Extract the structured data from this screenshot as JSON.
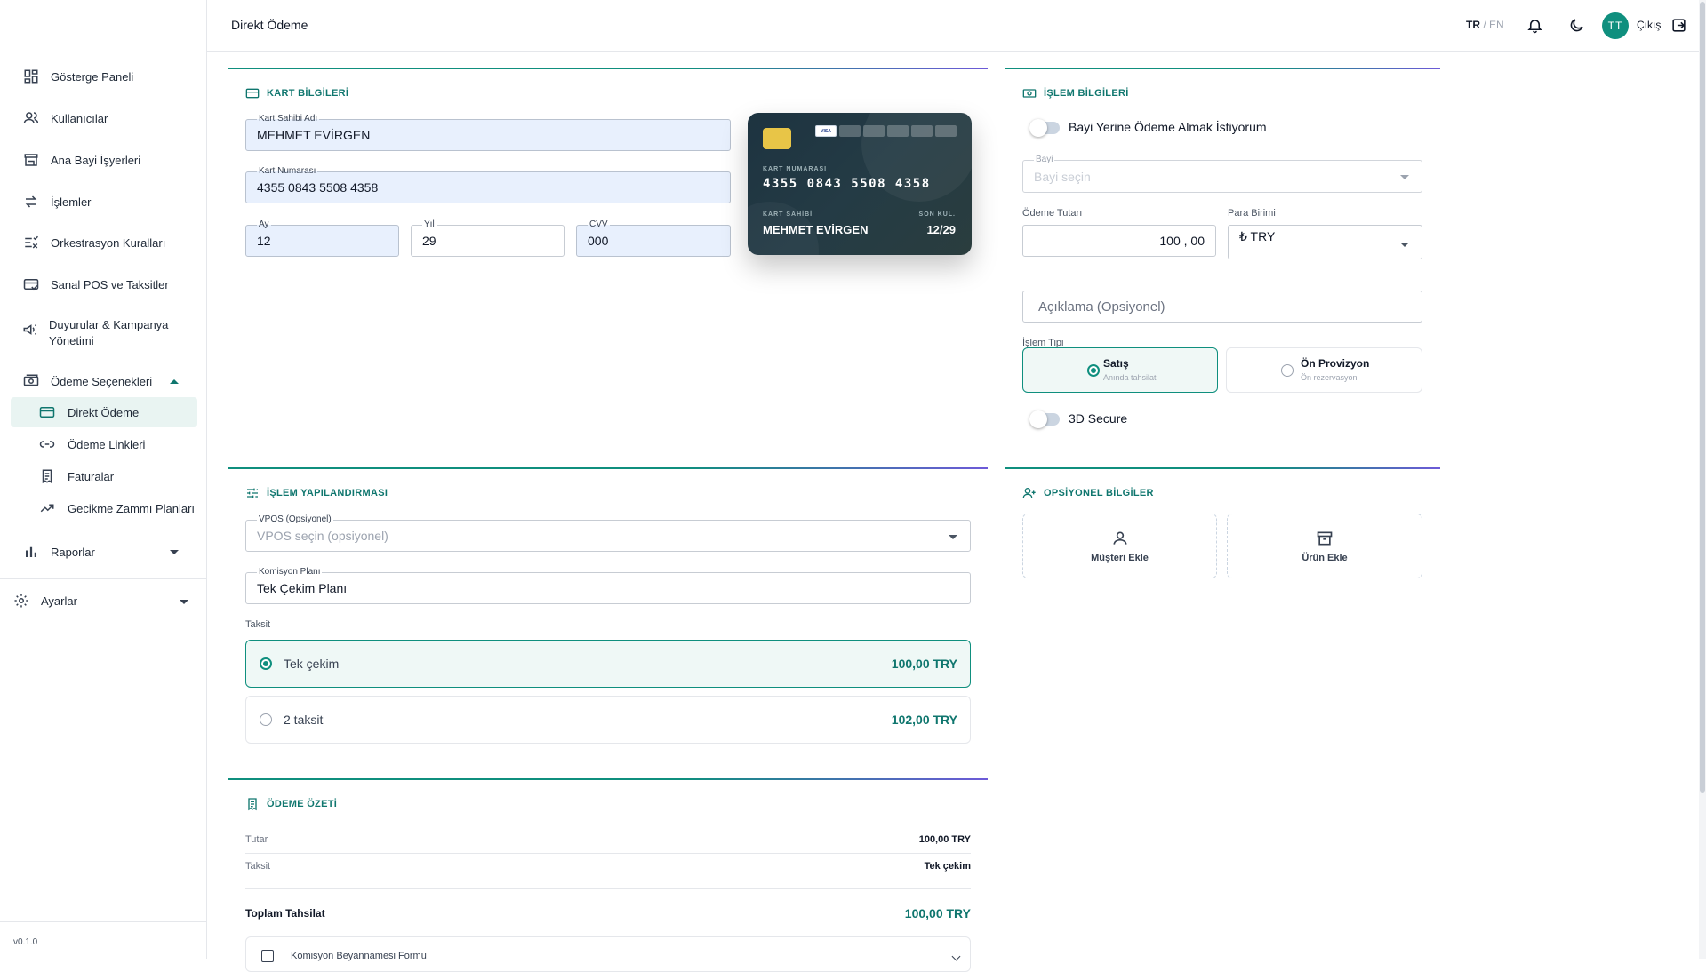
{
  "sidebar": {
    "items": [
      {
        "label": "Gösterge Paneli",
        "icon": "dashboard-icon"
      },
      {
        "label": "Kullanıcılar",
        "icon": "users-icon"
      },
      {
        "label": "Ana Bayi İşyerleri",
        "icon": "store-icon"
      },
      {
        "label": "İşlemler",
        "icon": "swap-icon"
      },
      {
        "label": "Orkestrasyon Kuralları",
        "icon": "rules-icon"
      },
      {
        "label": "Sanal POS ve Taksitler",
        "icon": "pos-icon"
      },
      {
        "label": "Duyurular & Kampanya Yönetimi",
        "icon": "megaphone-icon"
      },
      {
        "label": "Ödeme Seçenekleri",
        "icon": "payments-icon"
      }
    ],
    "payment_sub": [
      {
        "label": "Direkt Ödeme",
        "icon": "credit-card-icon",
        "active": true
      },
      {
        "label": "Ödeme Linkleri",
        "icon": "link-icon"
      },
      {
        "label": "Faturalar",
        "icon": "invoice-icon"
      },
      {
        "label": "Gecikme Zammı Planları",
        "icon": "trend-icon"
      }
    ],
    "reports": "Raporlar",
    "settings": "Ayarlar",
    "version": "v0.1.0"
  },
  "topbar": {
    "title": "Direkt Ödeme",
    "lang_active": "TR",
    "lang_sep": " / ",
    "lang_other": "EN",
    "avatar_initials": "TT",
    "logout": "Çıkış"
  },
  "card_info": {
    "title": "KART BİLGİLERİ",
    "holder_label": "Kart Sahibi Adı",
    "holder_value": "MEHMET EVİRGEN",
    "number_label": "Kart Numarası",
    "number_value": "4355 0843 5508 4358",
    "month_label": "Ay",
    "month_value": "12",
    "year_label": "Yıl",
    "year_value": "29",
    "cvv_label": "CVV",
    "cvv_value": "000"
  },
  "card_preview": {
    "brands": [
      "VISA",
      "",
      "",
      "",
      "",
      ""
    ],
    "number_caption": "KART NUMARASI",
    "number": "4355 0843 5508 4358",
    "holder_caption": "KART SAHİBİ",
    "holder": "MEHMET EVİRGEN",
    "exp_caption": "SON KUL.",
    "exp": "12/29"
  },
  "transaction_info": {
    "title": "İŞLEM BİLGİLERİ",
    "dealer_toggle": "Bayi Yerine Ödeme Almak İstiyorum",
    "dealer_label": "Bayi",
    "dealer_placeholder": "Bayi seçin",
    "amount_label": "Ödeme Tutarı",
    "amount_value": "100 , 00",
    "currency_label": "Para Birimi",
    "currency_value": "₺ TRY",
    "description_placeholder": "Açıklama (Opsiyonel)",
    "type_label": "İşlem Tipi",
    "type_sale": "Satış",
    "type_sale_sub": "Anında tahsilat",
    "type_preauth": "Ön Provizyon",
    "type_preauth_sub": "Ön rezervasyon",
    "secure_toggle": "3D Secure"
  },
  "config": {
    "title": "İŞLEM YAPILANDIRMASI",
    "vpos_label": "VPOS (Opsiyonel)",
    "vpos_placeholder": "VPOS seçin (opsiyonel)",
    "commission_label": "Komisyon Planı",
    "commission_value": "Tek Çekim Planı",
    "installment_label": "Taksit",
    "installments": [
      {
        "label": "Tek çekim",
        "amount": "100,00 TRY",
        "selected": true
      },
      {
        "label": "2 taksit",
        "amount": "102,00 TRY",
        "selected": false
      }
    ]
  },
  "optional": {
    "title": "OPSİYONEL BİLGİLER",
    "add_customer": "Müşteri Ekle",
    "add_product": "Ürün Ekle"
  },
  "summary": {
    "title": "ÖDEME ÖZETİ",
    "rows": [
      {
        "k": "Tutar",
        "v": "100,00 TRY"
      },
      {
        "k": "Taksit",
        "v": "Tek çekim"
      }
    ],
    "total_label": "Toplam Tahsilat",
    "total_value": "100,00 TRY",
    "commission_form": "Komisyon Beyannamesi Formu"
  },
  "colors": {
    "accent": "#0f8f7e",
    "accent_dark": "#0f766e",
    "gradient_end": "#6d5ad8",
    "filled_input": "#e8f0fd"
  }
}
